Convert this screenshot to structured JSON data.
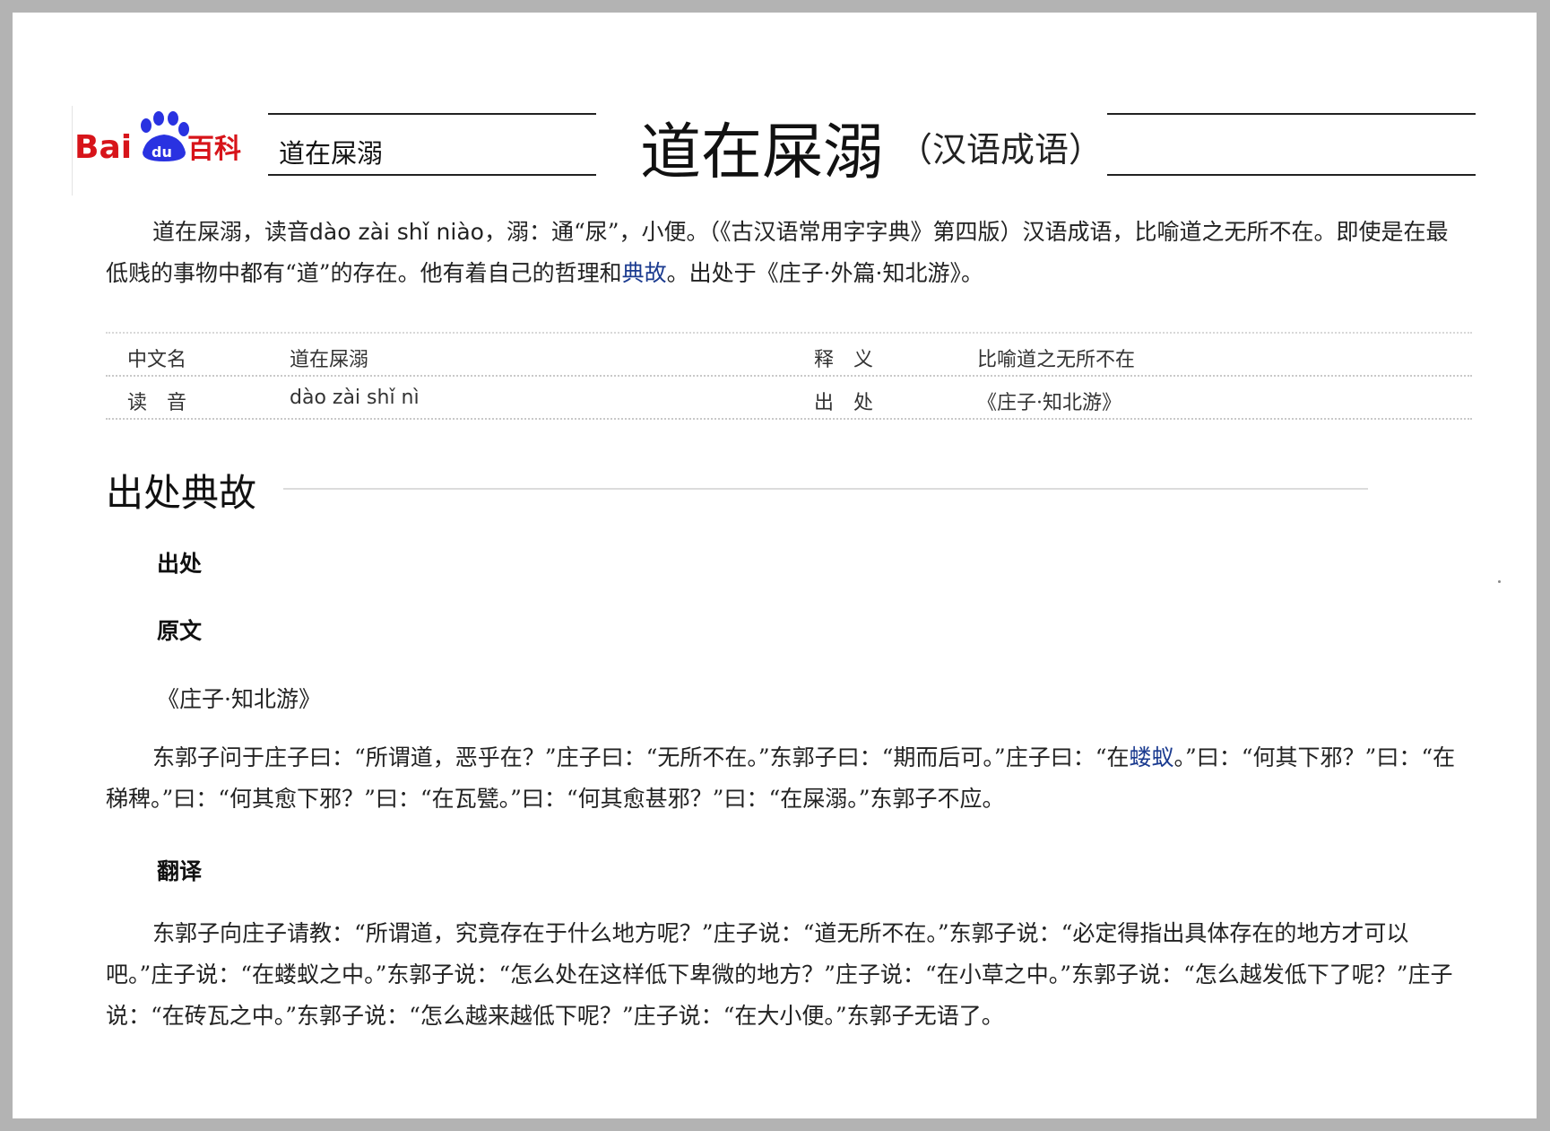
{
  "header": {
    "logo_text": "Bai du 百科",
    "search_value": "道在屎溺",
    "title": "道在屎溺",
    "subtitle": "（汉语成语）"
  },
  "intro": {
    "part1": "道在屎溺，读音",
    "pinyin": "dào zài shǐ niào",
    "part2": "，溺：通“尿”，小便。（《古汉语常用字字典》第四版）汉语成语，比喻道之无所不在。即使是在最低贱的事物中都有“道”的存在。他有着自己的哲理和",
    "link": "典故",
    "part3": "。出处于《庄子·外篇·知北游》。"
  },
  "infobox": {
    "rows": [
      {
        "label1": "中文名",
        "value1": "道在屎溺",
        "label2": "释　义",
        "value2": "比喻道之无所不在"
      },
      {
        "label1": "读　音",
        "value1": "dào zài shǐ nì",
        "label2": "出　处",
        "value2": "《庄子·知北游》"
      }
    ]
  },
  "section": {
    "title": "出处典故",
    "source_heading": "出处",
    "original_heading": "原文",
    "source_book": "《庄子·知北游》",
    "original": {
      "part1": "东郭子问于庄子曰：“所谓道，恶乎在？”庄子曰：“无所不在。”东郭子曰：“期而后可。”庄子曰：“在",
      "link": "蝼蚁",
      "part2": "。”曰：“何其下邪？”曰：“在稊稗。”曰：“何其愈下邪？”曰：“在瓦甓。”曰：“何其愈甚邪？”曰：“在屎溺。”东郭子不应。"
    },
    "translation_heading": "翻译",
    "translation": "东郭子向庄子请教：“所谓道，究竟存在于什么地方呢？”庄子说：“道无所不在。”东郭子说：“必定得指出具体存在的地方才可以吧。”庄子说：“在蝼蚁之中。”东郭子说：“怎么处在这样低下卑微的地方？”庄子说：“在小草之中。”东郭子说：“怎么越发低下了呢？”庄子说：“在砖瓦之中。”东郭子说：“怎么越来越低下呢？”庄子说：“在大小便。”东郭子无语了。"
  },
  "colors": {
    "brand_red": "#d7141a",
    "brand_blue": "#2932e1",
    "link": "#1a3a8f"
  }
}
